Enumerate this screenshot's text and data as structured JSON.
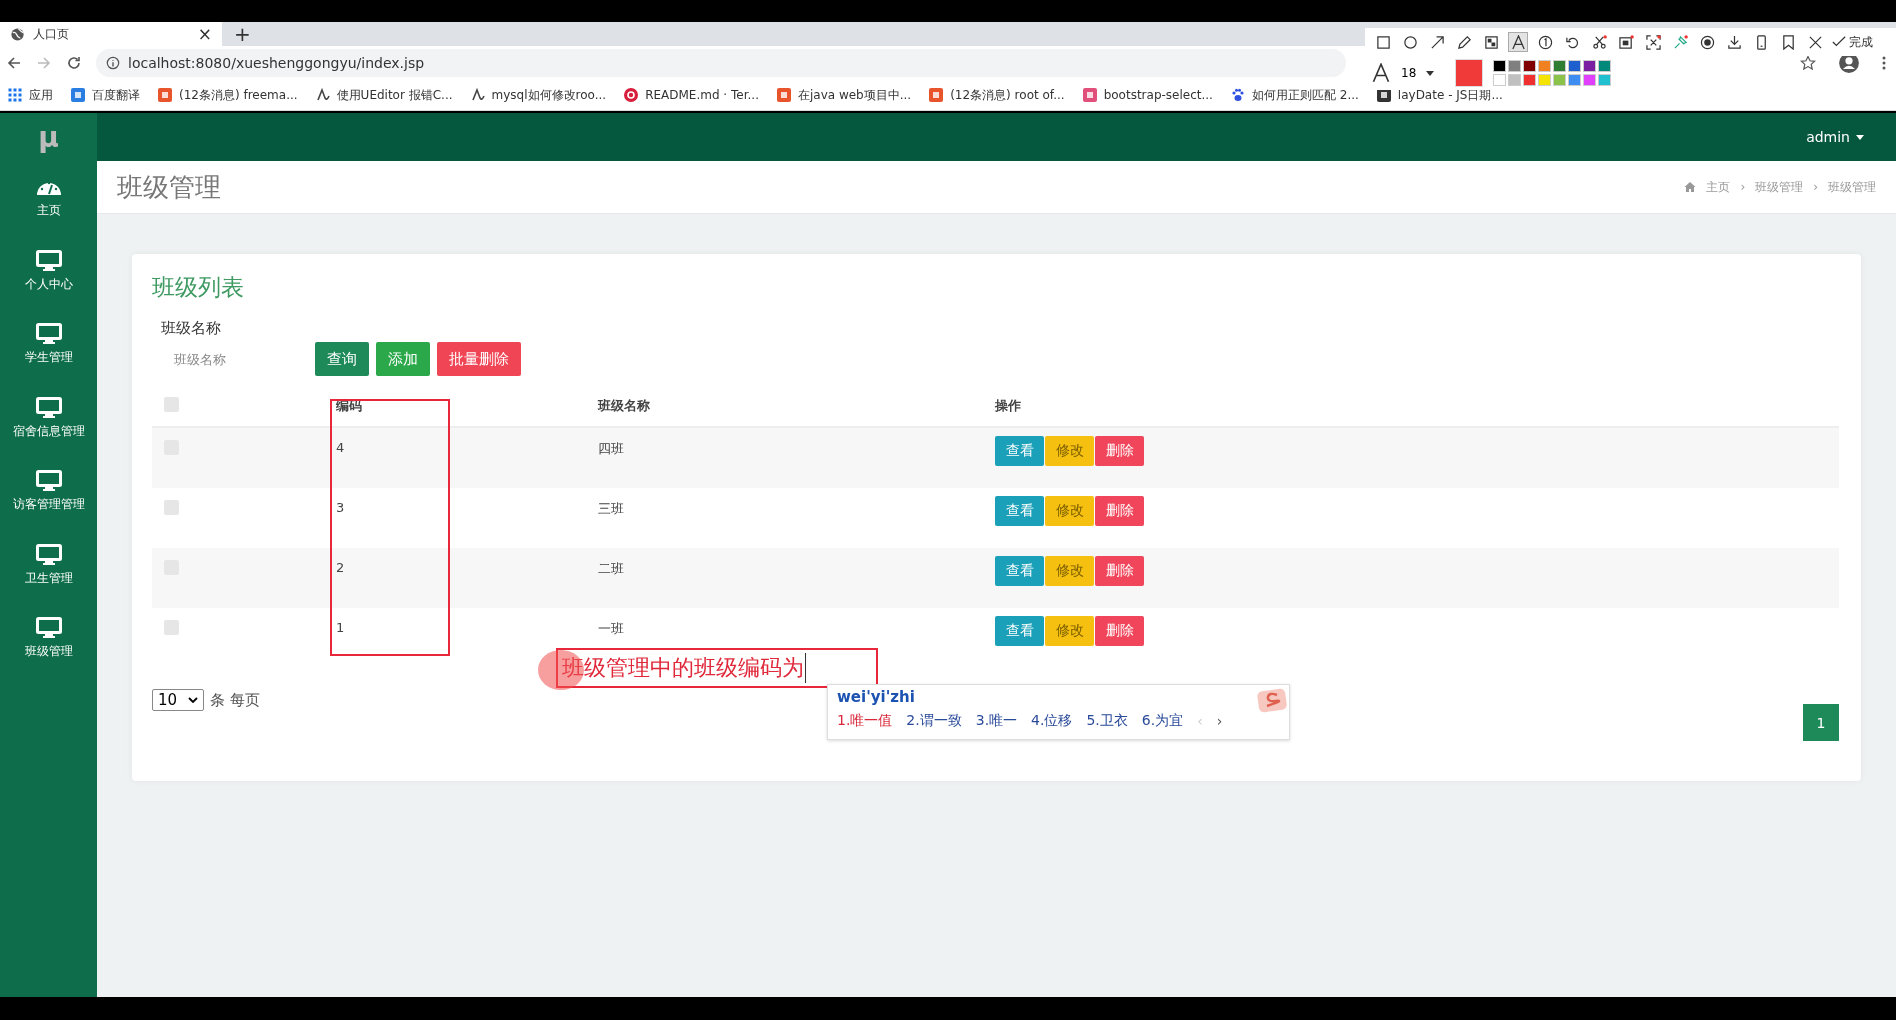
{
  "browser": {
    "tab": {
      "title": "人口页",
      "close": "×"
    },
    "new_tab": "+",
    "address": "localhost:8080/xueshenggongyu/index.jsp",
    "bookmarks": [
      {
        "label": "应用",
        "kind": "apps",
        "color": "#1a73e8"
      },
      {
        "label": "百度翻译",
        "kind": "tile",
        "color": "#2a7de1"
      },
      {
        "label": "(12条消息) freema...",
        "kind": "tile",
        "color": "#e8552d"
      },
      {
        "label": "使用UEditor 报错C...",
        "kind": "swirl",
        "color": "#444444"
      },
      {
        "label": "mysql如何修改roo...",
        "kind": "swirl",
        "color": "#444444"
      },
      {
        "label": "README.md · Ter...",
        "kind": "round",
        "color": "#d81e3c"
      },
      {
        "label": "在java web项目中...",
        "kind": "tile",
        "color": "#e8552d"
      },
      {
        "label": "(12条消息) root of...",
        "kind": "tile",
        "color": "#e8552d"
      },
      {
        "label": "bootstrap-select...",
        "kind": "tile",
        "color": "#e0507a"
      },
      {
        "label": "如何用正则匹配 2...",
        "kind": "paw",
        "color": "#3050e0"
      },
      {
        "label": "layDate - JS日期...",
        "kind": "tile",
        "color": "#333333"
      }
    ]
  },
  "capture_toolbar": {
    "tools": [
      {
        "kind": "rect",
        "selected": false
      },
      {
        "kind": "ellipse",
        "selected": false
      },
      {
        "kind": "arrow",
        "selected": false
      },
      {
        "kind": "pencil",
        "selected": false
      },
      {
        "kind": "mosaic",
        "selected": false
      },
      {
        "kind": "text",
        "selected": true
      },
      {
        "kind": "number",
        "selected": false
      },
      {
        "kind": "undo",
        "selected": false
      },
      {
        "kind": "scissors",
        "selected": false
      },
      {
        "kind": "frame",
        "selected": false
      },
      {
        "kind": "expand",
        "selected": false
      },
      {
        "kind": "pin",
        "selected": false
      },
      {
        "kind": "record",
        "selected": false
      },
      {
        "kind": "download",
        "selected": false
      },
      {
        "kind": "phone",
        "selected": false
      },
      {
        "kind": "bookmark",
        "selected": false
      },
      {
        "kind": "close",
        "selected": false
      }
    ],
    "done": "完成",
    "font_size": "18",
    "current_swatch": {
      "color": "#f03a3a"
    },
    "palette": [
      {
        "color": "#000000"
      },
      {
        "color": "#808080"
      },
      {
        "color": "#800000"
      },
      {
        "color": "#f08020"
      },
      {
        "color": "#2e7d32"
      },
      {
        "color": "#1e5fcf"
      },
      {
        "color": "#7b1fa2"
      },
      {
        "color": "#00897b"
      },
      {
        "color": "#ffffff"
      },
      {
        "color": "#c0c0c0"
      },
      {
        "color": "#f03030"
      },
      {
        "color": "#f5e400"
      },
      {
        "color": "#8bc34a"
      },
      {
        "color": "#3d8ef0"
      },
      {
        "color": "#e040fb"
      },
      {
        "color": "#20c0d0"
      }
    ]
  },
  "app": {
    "logo": "μ",
    "user": "admin",
    "sidebar": [
      {
        "label": "主页",
        "kind": "dashboard"
      },
      {
        "label": "个人中心",
        "kind": "monitor"
      },
      {
        "label": "学生管理",
        "kind": "monitor"
      },
      {
        "label": "宿舍信息管理",
        "kind": "monitor"
      },
      {
        "label": "访客管理管理",
        "kind": "monitor"
      },
      {
        "label": "卫生管理",
        "kind": "monitor"
      },
      {
        "label": "班级管理",
        "kind": "monitor"
      }
    ],
    "page_title": "班级管理",
    "breadcrumb": [
      {
        "label": "主页"
      },
      {
        "separator": "›",
        "label": "班级管理"
      },
      {
        "separator": "›",
        "label": "班级管理"
      }
    ],
    "card": {
      "title": "班级列表",
      "filter_label": "班级名称",
      "filter_placeholder": "班级名称",
      "buttons": [
        {
          "label": "查询",
          "kind": "search"
        },
        {
          "label": "添加",
          "kind": "add"
        },
        {
          "label": "批量删除",
          "kind": "delete"
        }
      ],
      "table": {
        "select_all": {
          "checked": false
        },
        "columns": [
          "编码",
          "班级名称",
          "操作"
        ],
        "rows": [
          {
            "checked": false,
            "code": "4",
            "name": "四班",
            "actions": [
              "查看",
              "修改",
              "删除"
            ]
          },
          {
            "checked": false,
            "code": "3",
            "name": "三班",
            "actions": [
              "查看",
              "修改",
              "删除"
            ]
          },
          {
            "checked": false,
            "code": "2",
            "name": "二班",
            "actions": [
              "查看",
              "修改",
              "删除"
            ]
          },
          {
            "checked": false,
            "code": "1",
            "name": "一班",
            "actions": [
              "查看",
              "修改",
              "删除"
            ]
          }
        ]
      },
      "page_size": "10",
      "page_size_label": "条 每页",
      "pages": [
        {
          "label": "1",
          "selected": true
        }
      ]
    }
  },
  "annotation": {
    "note": "班级管理中的班级编码为",
    "ime": {
      "input": "wei'yi'zhi",
      "candidates": [
        {
          "label": "1.唯一值",
          "selected": true
        },
        {
          "label": "2.谓一致",
          "selected": false
        },
        {
          "label": "3.唯一",
          "selected": false
        },
        {
          "label": "4.位移",
          "selected": false
        },
        {
          "label": "5.卫衣",
          "selected": false
        },
        {
          "label": "6.为宜",
          "selected": false
        }
      ],
      "prev": "‹",
      "next": "›"
    }
  }
}
